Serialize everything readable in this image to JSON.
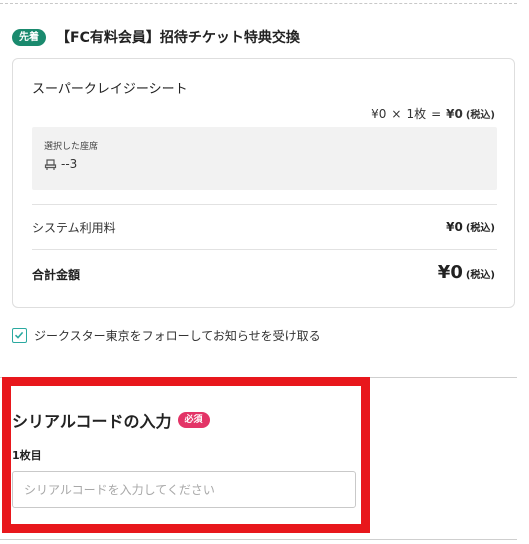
{
  "ticket": {
    "badge": "先着",
    "title": "【FC有料会員】招待チケット特典交換",
    "seat_name": "スーパークレイジーシート",
    "price_unit": "¥0",
    "times": "×",
    "quantity": "1枚",
    "equals": "=",
    "price_total": "¥0",
    "tax_note": "(税込)",
    "selected_seat_label": "選択した座席",
    "selected_seat_value": "--3",
    "seat_icon": "seat-icon"
  },
  "fees": {
    "system_fee_label": "システム利用料",
    "system_fee_value": "¥0",
    "tax_note": "(税込)",
    "total_label": "合計金額",
    "total_value": "¥0",
    "total_tax_note": "(税込)"
  },
  "follow": {
    "checked": true,
    "label": "ジークスター東京をフォローしてお知らせを受け取る"
  },
  "serial": {
    "title": "シリアルコードの入力",
    "required_badge": "必須",
    "sheet_label": "1枚目",
    "placeholder": "シリアルコードを入力してください",
    "value": ""
  },
  "colors": {
    "badge_green": "#1a8a6e",
    "required_pink": "#e33467",
    "checkbox_teal": "#2aa9a0",
    "highlight_red": "#e8171c"
  }
}
